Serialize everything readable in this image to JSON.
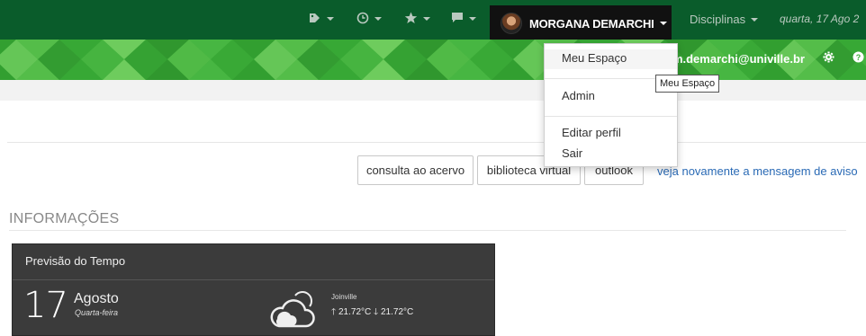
{
  "topbar": {
    "icons": [
      {
        "name": "tag-icon",
        "glyph": "◆"
      },
      {
        "name": "clock-icon",
        "glyph": "◴"
      },
      {
        "name": "star-icon",
        "glyph": "★"
      },
      {
        "name": "chat-icon",
        "glyph": "▬"
      }
    ],
    "user_name": "MORGANA DEMARCHI",
    "disciplinas_label": "Disciplinas",
    "date_text": "quarta, 17 Ago 2"
  },
  "banner": {
    "email": "m.demarchi@univille.br",
    "email_icon": "envelope-icon",
    "gear_icon": "gear-icon",
    "help_icon": "help-icon"
  },
  "user_menu": {
    "items": [
      "Meu Espaço",
      "Admin",
      "Editar perfil",
      "Sair"
    ],
    "tooltip": "Meu Espaço"
  },
  "quick_links": {
    "consulta": "consulta ao acervo",
    "biblioteca": "biblioteca virtual",
    "outlook": "outlook",
    "aviso": "veja novamente a mensagem de aviso"
  },
  "info": {
    "title": "INFORMAÇÕES"
  },
  "weather": {
    "title": "Previsão do Tempo",
    "day": "17",
    "month": "Agosto",
    "weekday": "Quarta-feira",
    "city": "Joinville",
    "max_temp": "21.72°C",
    "min_temp": "21.72°C",
    "icon": "cloud-icon"
  },
  "colors": {
    "navbar": "#0a5c2b",
    "banner": "#3fae3a",
    "link": "#2a6ab5",
    "widget": "#3b3b3b"
  }
}
